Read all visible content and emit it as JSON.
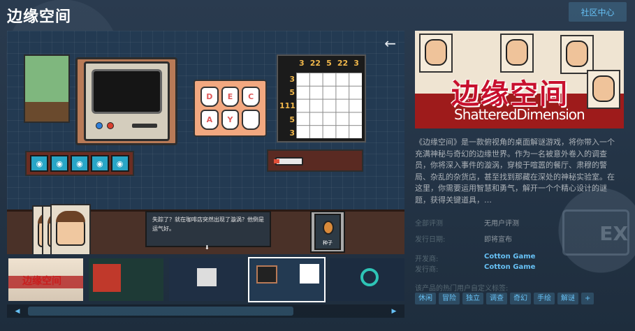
{
  "page": {
    "title": "边缘空间",
    "community_button": "社区中心"
  },
  "main_screenshot": {
    "nonogram": {
      "col_clues": [
        "3",
        "22",
        "5",
        "22",
        "3"
      ],
      "row_clues": [
        "3",
        "5",
        "111",
        "5",
        "3"
      ]
    },
    "tooth_letters": [
      "D",
      "E",
      "C",
      "A",
      "Y",
      ""
    ],
    "dialog_text": "失踪了？就在咖啡店突然出现了漩涡？他倒是运气好。",
    "item_label": "种子"
  },
  "capsule": {
    "cn_title": "边缘空间",
    "en_title": "ShatteredDimension"
  },
  "description": "《边缘空间》是一款俯视角的桌面解谜游戏，将你带入一个充满神秘与奇幻的边缘世界。作为一名被意外卷入的调查员，你将深入事件的漩涡，穿梭于喧嚣的餐厅、肃穆的警局、杂乱的杂货店，甚至找到那藏在深处的神秘实验室。在这里，你需要运用智慧和勇气，解开一个个精心设计的谜题，获得关键道具，…",
  "reviews": {
    "label": "全部评测",
    "value": "无用户评测"
  },
  "release": {
    "label": "发行日期:",
    "value": "即将宣布"
  },
  "developer": {
    "label": "开发商:",
    "value": "Cotton Game"
  },
  "publisher": {
    "label": "发行商:",
    "value": "Cotton Game"
  },
  "tags": {
    "label": "该产品的热门用户自定义标签:",
    "items": [
      "休闲",
      "冒险",
      "独立",
      "调查",
      "奇幻",
      "手绘",
      "解谜",
      "+"
    ]
  },
  "scroll": {
    "left": "◀",
    "right": "▶"
  }
}
